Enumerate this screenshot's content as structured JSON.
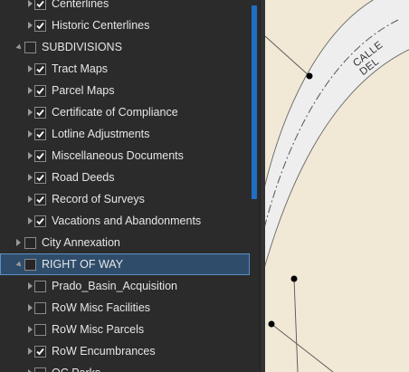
{
  "layers": [
    {
      "label": "Centerlines",
      "level": 1,
      "expander": "collapsed",
      "checked": true
    },
    {
      "label": "Historic Centerlines",
      "level": 1,
      "expander": "collapsed",
      "checked": true
    },
    {
      "label": "SUBDIVISIONS",
      "level": 0,
      "expander": "expanded",
      "checked": false
    },
    {
      "label": "Tract Maps",
      "level": 1,
      "expander": "collapsed",
      "checked": true
    },
    {
      "label": "Parcel Maps",
      "level": 1,
      "expander": "collapsed",
      "checked": true
    },
    {
      "label": "Certificate of Compliance",
      "level": 1,
      "expander": "collapsed",
      "checked": true
    },
    {
      "label": "Lotline Adjustments",
      "level": 1,
      "expander": "collapsed",
      "checked": true
    },
    {
      "label": "Miscellaneous Documents",
      "level": 1,
      "expander": "collapsed",
      "checked": true
    },
    {
      "label": "Road Deeds",
      "level": 1,
      "expander": "collapsed",
      "checked": true
    },
    {
      "label": "Record of Surveys",
      "level": 1,
      "expander": "collapsed",
      "checked": true
    },
    {
      "label": "Vacations and Abandonments",
      "level": 1,
      "expander": "collapsed",
      "checked": true
    },
    {
      "label": "City Annexation",
      "level": 0,
      "expander": "collapsed",
      "checked": false
    },
    {
      "label": "RIGHT OF WAY",
      "level": 0,
      "expander": "expanded",
      "checked": false,
      "selected": true
    },
    {
      "label": "Prado_Basin_Acquisition",
      "level": 1,
      "expander": "collapsed",
      "checked": false
    },
    {
      "label": "RoW Misc Facilities",
      "level": 1,
      "expander": "collapsed",
      "checked": false
    },
    {
      "label": "RoW Misc Parcels",
      "level": 1,
      "expander": "collapsed",
      "checked": false
    },
    {
      "label": "RoW Encumbrances",
      "level": 1,
      "expander": "collapsed",
      "checked": true
    },
    {
      "label": "OC Parks",
      "level": 1,
      "expander": "collapsed",
      "checked": false
    }
  ],
  "map": {
    "street_label": "CALLE DEL",
    "colors": {
      "background": "#f1e8d6",
      "road": "#eeeeee",
      "road_edge": "#666666",
      "centerline": "#555555",
      "vertex": "#000000"
    }
  },
  "colors": {
    "panel_bg": "#2b2b2b",
    "text": "#e6e6e6",
    "accent": "#1f6fc7",
    "selection_bg": "#2f4d6b",
    "selection_border": "#5b8fc4"
  }
}
